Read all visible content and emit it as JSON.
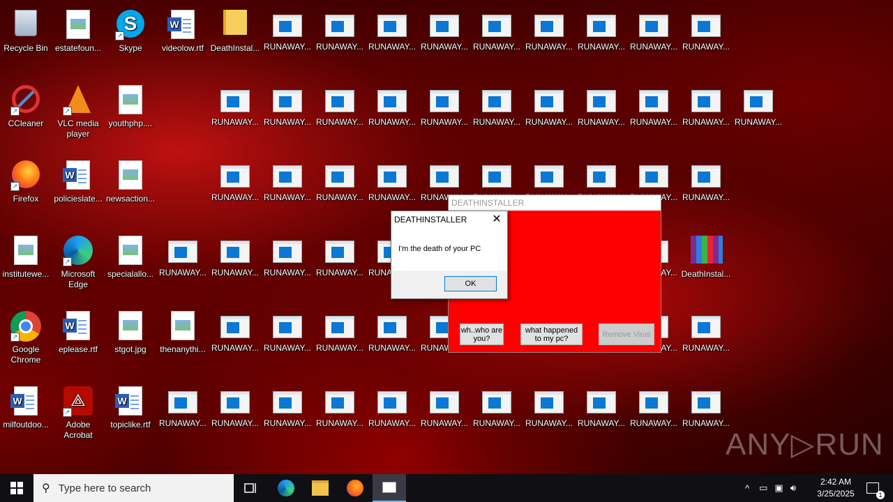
{
  "desktop_icons": [
    {
      "label": "Recycle Bin",
      "icon": "recycle-bin-icon"
    },
    {
      "label": "estatefoun...",
      "icon": "image-file-icon"
    },
    {
      "label": "Skype",
      "icon": "skype-icon"
    },
    {
      "label": "videolow.rtf",
      "icon": "word-doc-icon"
    },
    {
      "label": "DeathInstal...",
      "icon": "folder-icon"
    },
    {
      "label": "CCleaner",
      "icon": "ccleaner-icon"
    },
    {
      "label": "VLC media player",
      "icon": "vlc-icon"
    },
    {
      "label": "youthphp....",
      "icon": "image-file-icon"
    },
    {
      "label": "Firefox",
      "icon": "firefox-icon"
    },
    {
      "label": "policieslate...",
      "icon": "word-doc-icon"
    },
    {
      "label": "newsaction...",
      "icon": "image-file-icon"
    },
    {
      "label": "institutewe...",
      "icon": "image-file-icon"
    },
    {
      "label": "Microsoft Edge",
      "icon": "edge-icon"
    },
    {
      "label": "specialallo...",
      "icon": "image-file-icon"
    },
    {
      "label": "DeathInstal...",
      "icon": "winrar-icon"
    },
    {
      "label": "Google Chrome",
      "icon": "chrome-icon"
    },
    {
      "label": "eplease.rtf",
      "icon": "word-doc-icon"
    },
    {
      "label": "stgot.jpg",
      "icon": "image-file-icon"
    },
    {
      "label": "thenanythi...",
      "icon": "image-file-icon"
    },
    {
      "label": "milfoutdoo...",
      "icon": "word-doc-icon"
    },
    {
      "label": "Adobe Acrobat",
      "icon": "acrobat-icon"
    },
    {
      "label": "topiclike.rtf",
      "icon": "word-doc-icon"
    }
  ],
  "runaway_label": "RUNAWAY...",
  "back_window": {
    "title": "DEATHINSTALLER",
    "buttons": [
      "wh..who are you?",
      "what happened to my pc?",
      "Remove Virus"
    ],
    "bg_color": "#ff0000"
  },
  "message_box": {
    "title": "DEATHINSTALLER",
    "message": "I'm the death of your PC",
    "ok_label": "OK"
  },
  "watermark": "ANY▷RUN",
  "taskbar": {
    "search_placeholder": "Type here to search",
    "clock_time": "2:42 AM",
    "clock_date": "3/25/2025",
    "notification_count": "1"
  }
}
